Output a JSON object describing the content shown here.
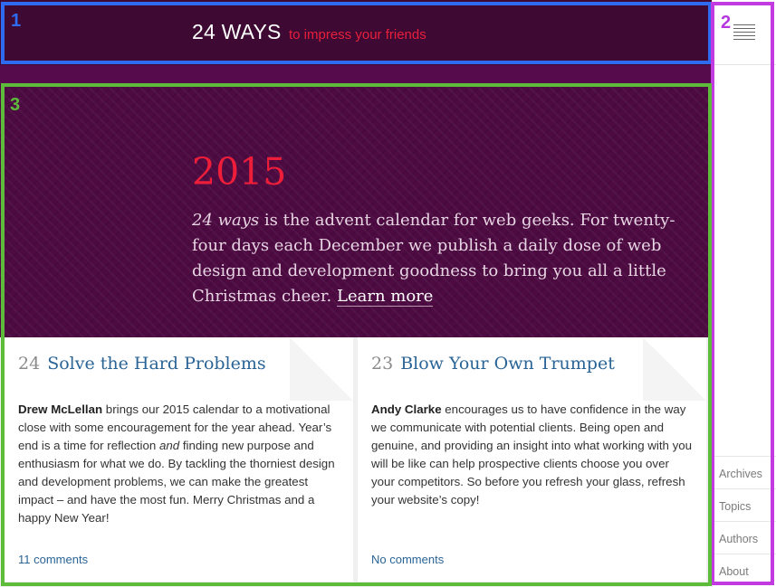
{
  "header": {
    "brand_name": "24 WAYS",
    "tagline": "to impress your friends"
  },
  "hero": {
    "year": "2015",
    "intro_em": "24 ways",
    "intro_text": " is the advent calendar for web geeks. For twenty-four days each December we publish a daily dose of web design and development goodness to bring you all a little Christmas cheer. ",
    "learn_more": "Learn more"
  },
  "articles": [
    {
      "day": "24",
      "title": "Solve the Hard Problems",
      "author": "Drew McLellan",
      "body_1": " brings our 2015 calendar to a motivational close with some encouragement for the year ahead. Year’s end is a time for reflection ",
      "body_em": "and",
      "body_2": " finding new purpose and enthusiasm for what we do. By tackling the thorniest design and development problems, we can make the greatest impact – and have the most fun. Merry Christmas and a happy New Year!",
      "comments": "11 comments"
    },
    {
      "day": "23",
      "title": "Blow Your Own Trumpet",
      "author": "Andy Clarke",
      "body_1": " encourages us to have confidence in the way we communicate with potential clients. Being open and genuine, and providing an insight into what working with you will be like can help prospective clients choose you over your competitors. So before you refresh your glass, refresh your website’s copy!",
      "body_em": "",
      "body_2": "",
      "comments": "No comments"
    }
  ],
  "sidebar": {
    "menu_icon": "hamburger-menu-icon",
    "nav": [
      "Archives",
      "Topics",
      "Authors",
      "About"
    ]
  },
  "annotations": {
    "header_region": "1",
    "sidebar_region": "2",
    "content_region": "3"
  },
  "colors": {
    "header_bg": "#3e0a33",
    "hero_bg": "#4d0b42",
    "accent_red": "#ee1d3a",
    "link_blue": "#2a6496",
    "box_1": "#2e6bf0",
    "box_2": "#c13be0",
    "box_3": "#5dbd3b"
  }
}
